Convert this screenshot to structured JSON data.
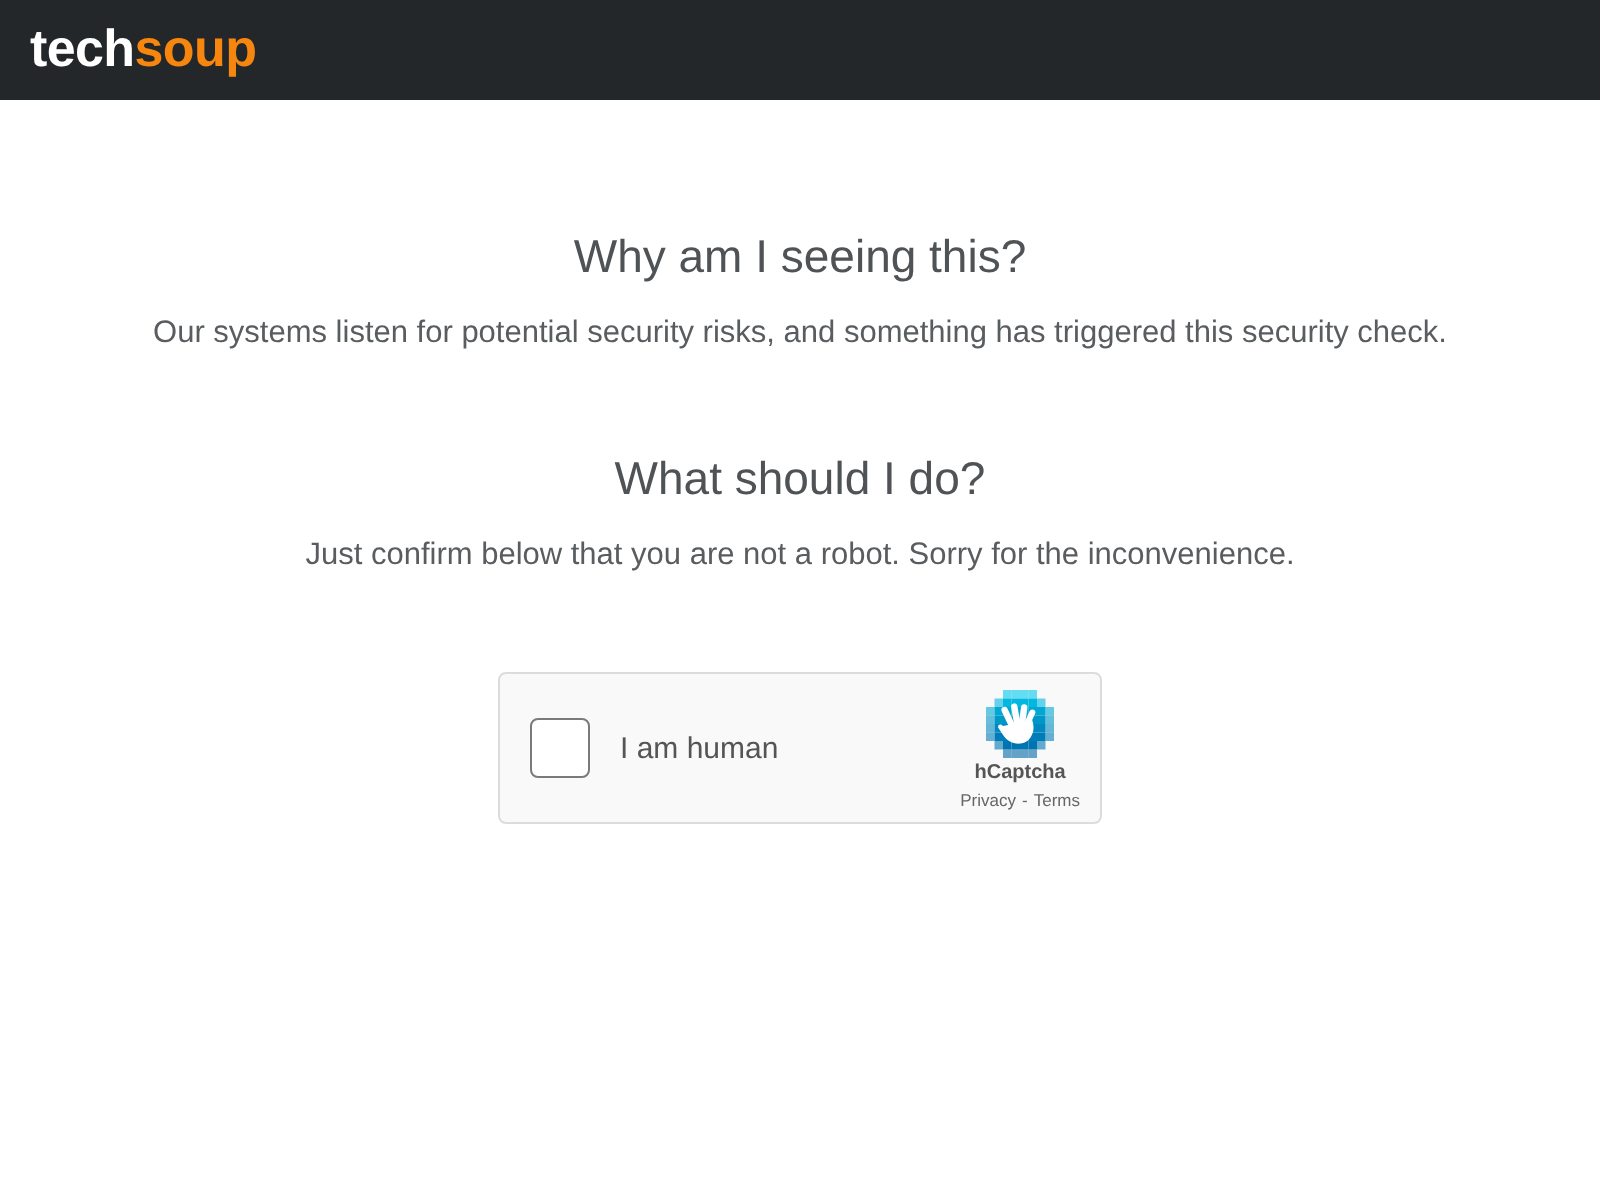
{
  "header": {
    "logo": {
      "part_1": "tech",
      "part_2": "soup"
    }
  },
  "sections": [
    {
      "heading": "Why am I seeing this?",
      "text": "Our systems listen for potential security risks, and something has triggered this security check."
    },
    {
      "heading": "What should I do?",
      "text": "Just confirm below that you are not a robot. Sorry for the inconvenience."
    }
  ],
  "captcha": {
    "checked": false,
    "label": "I am human",
    "brand": "hCaptcha",
    "links": [
      "Privacy",
      "Terms"
    ],
    "separator": "-"
  }
}
